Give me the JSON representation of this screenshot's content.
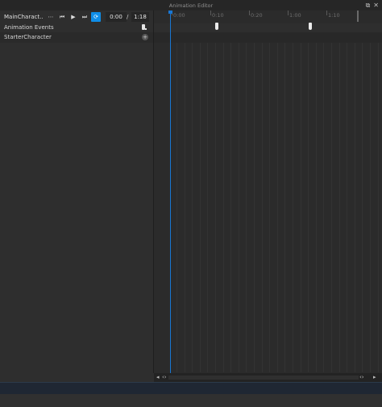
{
  "window": {
    "title": "Animation Editor"
  },
  "toolbar": {
    "rig_name": "MainCharact…",
    "current_time": "0:00",
    "separator": "/",
    "total_time": "1:18"
  },
  "tracks": [
    {
      "label": "Animation Events"
    },
    {
      "label": "StarterCharacter"
    }
  ],
  "ruler": {
    "labels": [
      "0:00",
      "0:10",
      "0:20",
      "1:00",
      "1:10"
    ]
  },
  "colors": {
    "accent": "#0f8ee8",
    "playhead": "#1976d2",
    "background": "#2e2e2e"
  },
  "icons": {
    "more": "more-dots-icon",
    "first_frame": "skip-back-icon",
    "play": "play-icon",
    "last_frame": "skip-forward-icon",
    "loop": "loop-icon",
    "popout": "popout-icon",
    "close": "close-icon",
    "add": "add-icon"
  }
}
